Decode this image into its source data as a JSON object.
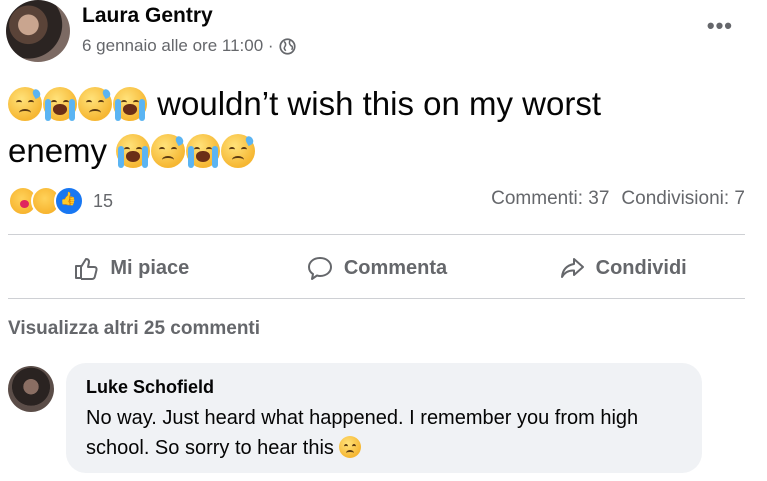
{
  "post": {
    "author": "Laura Gentry",
    "timestamp": "6 gennaio alle ore 11:00 ·",
    "more_label": "•••",
    "text_before": "wouldn’t wish this on my worst",
    "text_after": "enemy",
    "emojis_lead": [
      "sad-sweat-emoji",
      "crying-emoji",
      "sad-sweat-emoji",
      "crying-emoji"
    ],
    "emojis_trail": [
      "crying-emoji",
      "sad-sweat-emoji",
      "crying-emoji",
      "sad-sweat-emoji"
    ]
  },
  "reactions": {
    "count": "15",
    "types": [
      "care-reaction",
      "sad-reaction",
      "like-reaction"
    ]
  },
  "stats": {
    "comments": "Commenti: 37",
    "shares": "Condivisioni: 7"
  },
  "actions": {
    "like": "Mi piace",
    "comment": "Commenta",
    "share": "Condividi"
  },
  "comments_section": {
    "view_more": "Visualizza altri 25 commenti",
    "comment": {
      "author": "Luke Schofield",
      "text": "No way. Just heard what happened. I remember you from high school. So sorry to hear this"
    }
  },
  "colors": {
    "secondary_text": "#65676b",
    "comment_bubble": "#f0f2f5",
    "divider": "#ced0d4",
    "like_blue": "#1877f2"
  }
}
